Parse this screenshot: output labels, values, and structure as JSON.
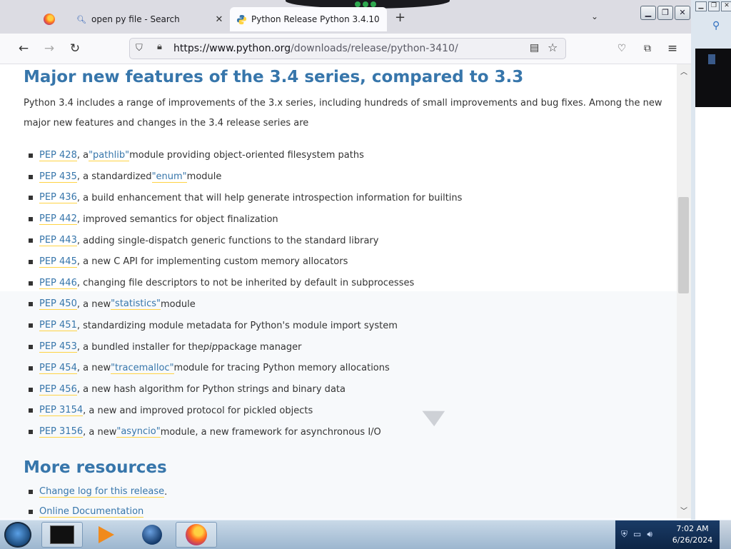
{
  "browser": {
    "tabs": [
      {
        "label": "",
        "icon": "firefox-icon"
      },
      {
        "label": "open py file - Search",
        "icon": "search-icon"
      },
      {
        "label": "Python Release Python 3.4.10",
        "icon": "python-icon"
      }
    ],
    "close_symbol": "✕",
    "new_tab_symbol": "+",
    "url_host": "https://www.python.org",
    "url_path": "/downloads/release/python-3410/"
  },
  "page": {
    "heading": "Major new features of the 3.4 series, compared to 3.3",
    "intro": "Python 3.4 includes a range of improvements of the 3.x series, including hundreds of small improvements and bug fixes. Among the new major new features and changes in the 3.4 release series are",
    "features": [
      {
        "pep": "PEP 428",
        "pre": ", a ",
        "code": "\"pathlib\"",
        "post": " module providing object-oriented filesystem paths"
      },
      {
        "pep": "PEP 435",
        "pre": ", a standardized ",
        "code": "\"enum\"",
        "post": " module"
      },
      {
        "pep": "PEP 436",
        "pre": ", a build enhancement that will help generate introspection information for builtins",
        "code": "",
        "post": ""
      },
      {
        "pep": "PEP 442",
        "pre": ", improved semantics for object finalization",
        "code": "",
        "post": ""
      },
      {
        "pep": "PEP 443",
        "pre": ", adding single-dispatch generic functions to the standard library",
        "code": "",
        "post": ""
      },
      {
        "pep": "PEP 445",
        "pre": ", a new C API for implementing custom memory allocators",
        "code": "",
        "post": ""
      },
      {
        "pep": "PEP 446",
        "pre": ", changing file descriptors to not be inherited by default in subprocesses",
        "code": "",
        "post": ""
      },
      {
        "pep": "PEP 450",
        "pre": ", a new ",
        "code": "\"statistics\"",
        "post": " module"
      },
      {
        "pep": "PEP 451",
        "pre": ", standardizing module metadata for Python's module import system",
        "code": "",
        "post": ""
      },
      {
        "pep": "PEP 453",
        "pre": ", a bundled installer for the ",
        "code": "",
        "post": "",
        "em": "pip",
        "post2": " package manager"
      },
      {
        "pep": "PEP 454",
        "pre": ", a new ",
        "code": "\"tracemalloc\"",
        "post": " module for tracing Python memory allocations"
      },
      {
        "pep": "PEP 456",
        "pre": ", a new hash algorithm for Python strings and binary data",
        "code": "",
        "post": ""
      },
      {
        "pep": "PEP 3154",
        "pre": ", a new and improved protocol for pickled objects",
        "code": "",
        "post": ""
      },
      {
        "pep": "PEP 3156",
        "pre": ", a new ",
        "code": "\"asyncio\"",
        "post": " module, a new framework for asynchronous I/O"
      }
    ],
    "resources_heading": "More resources",
    "resources": [
      {
        "label": "Change log for this release",
        "suffix": "."
      },
      {
        "label": "Online Documentation",
        "suffix": ""
      }
    ]
  },
  "taskbar": {
    "time": "7:02 AM",
    "date": "6/26/2024"
  }
}
